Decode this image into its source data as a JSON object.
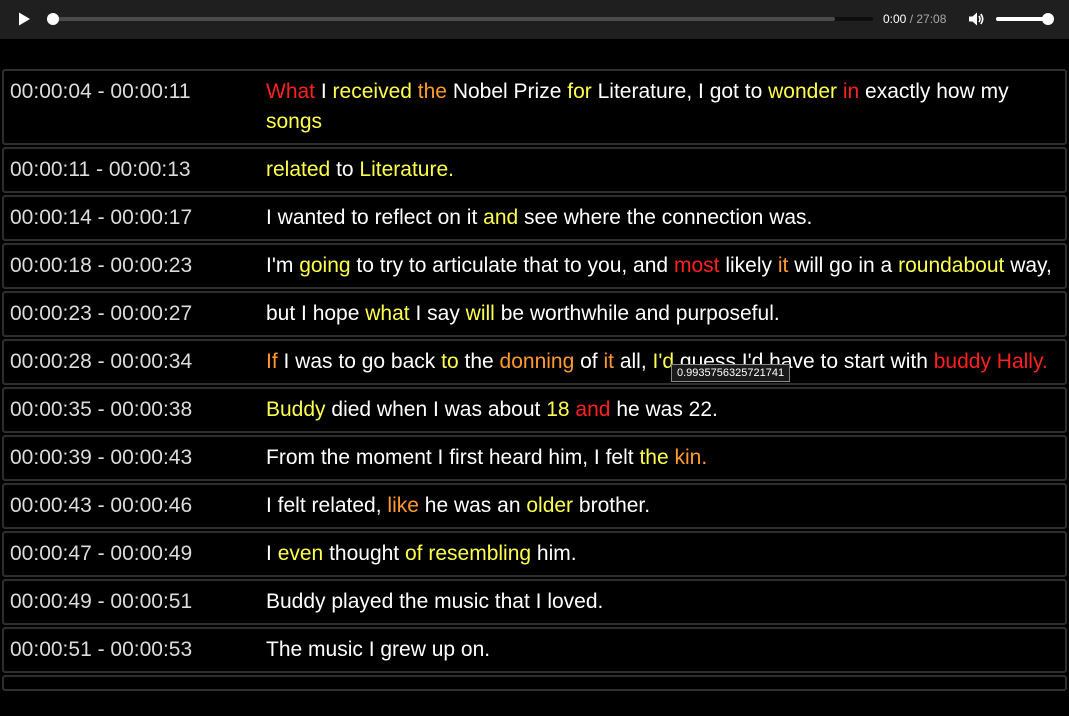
{
  "player": {
    "current_time": "0:00",
    "separator": " / ",
    "duration": "27:08",
    "progress_fraction": 0.0,
    "volume_fraction": 1.0
  },
  "tooltip": "0.9935756325721741",
  "colors": {
    "yellow": "#ffff4d",
    "orange": "#ff9a2e",
    "red": "#ff2020",
    "default": "#ffffff"
  },
  "cues": [
    {
      "time": "00:00:04 - 00:00:11",
      "words": [
        [
          "What",
          "r"
        ],
        [
          " ",
          ""
        ],
        [
          "I",
          ""
        ],
        [
          " ",
          ""
        ],
        [
          "received",
          "y"
        ],
        [
          " ",
          ""
        ],
        [
          "the",
          "o"
        ],
        [
          " ",
          ""
        ],
        [
          "Nobel",
          ""
        ],
        [
          " ",
          ""
        ],
        [
          "Prize",
          ""
        ],
        [
          " ",
          ""
        ],
        [
          "for",
          "y"
        ],
        [
          " ",
          ""
        ],
        [
          "Literature,",
          ""
        ],
        [
          " ",
          ""
        ],
        [
          "I",
          ""
        ],
        [
          " ",
          ""
        ],
        [
          "got",
          ""
        ],
        [
          " ",
          ""
        ],
        [
          "to",
          ""
        ],
        [
          " ",
          ""
        ],
        [
          "wonder",
          "y"
        ],
        [
          " ",
          ""
        ],
        [
          "in",
          "r"
        ],
        [
          " ",
          ""
        ],
        [
          "exactly",
          ""
        ],
        [
          " ",
          ""
        ],
        [
          "how",
          ""
        ],
        [
          " ",
          ""
        ],
        [
          "my",
          ""
        ],
        [
          " ",
          ""
        ],
        [
          "songs",
          "y"
        ]
      ]
    },
    {
      "time": "00:00:11 - 00:00:13",
      "words": [
        [
          "related",
          "y"
        ],
        [
          " ",
          ""
        ],
        [
          "to",
          ""
        ],
        [
          " ",
          ""
        ],
        [
          "Literature.",
          "y"
        ]
      ]
    },
    {
      "time": "00:00:14 - 00:00:17",
      "words": [
        [
          "I wanted to reflect on it",
          ""
        ],
        [
          " ",
          ""
        ],
        [
          "and",
          "y"
        ],
        [
          " ",
          ""
        ],
        [
          "see where the connection was.",
          ""
        ]
      ]
    },
    {
      "time": "00:00:18 - 00:00:23",
      "words": [
        [
          "I'm",
          ""
        ],
        [
          " ",
          ""
        ],
        [
          "going",
          "y"
        ],
        [
          " ",
          ""
        ],
        [
          "to try to articulate that to you, and",
          ""
        ],
        [
          " ",
          ""
        ],
        [
          "most",
          "r"
        ],
        [
          " ",
          ""
        ],
        [
          "likely",
          ""
        ],
        [
          " ",
          ""
        ],
        [
          "it",
          "o"
        ],
        [
          " ",
          ""
        ],
        [
          "will go in a",
          ""
        ],
        [
          " ",
          ""
        ],
        [
          "roundabout",
          "y"
        ],
        [
          " ",
          ""
        ],
        [
          "way,",
          ""
        ]
      ]
    },
    {
      "time": "00:00:23 - 00:00:27",
      "words": [
        [
          "but I hope",
          ""
        ],
        [
          " ",
          ""
        ],
        [
          "what",
          "y"
        ],
        [
          " ",
          ""
        ],
        [
          "I say",
          ""
        ],
        [
          " ",
          ""
        ],
        [
          "will",
          "y"
        ],
        [
          " ",
          ""
        ],
        [
          "be worthwhile and purposeful.",
          ""
        ]
      ]
    },
    {
      "time": "00:00:28 - 00:00:34",
      "words": [
        [
          "If",
          "o"
        ],
        [
          " ",
          ""
        ],
        [
          "I was",
          ""
        ],
        [
          " ",
          ""
        ],
        [
          "to go back",
          ""
        ],
        [
          " ",
          ""
        ],
        [
          "to",
          "y"
        ],
        [
          " ",
          ""
        ],
        [
          "the",
          ""
        ],
        [
          " ",
          ""
        ],
        [
          "donning",
          "o"
        ],
        [
          " ",
          ""
        ],
        [
          "of",
          ""
        ],
        [
          " ",
          ""
        ],
        [
          "it",
          "o"
        ],
        [
          " ",
          ""
        ],
        [
          "all,",
          ""
        ],
        [
          " ",
          ""
        ],
        [
          "I'd",
          "y"
        ],
        [
          " ",
          ""
        ],
        [
          "guess I'd have to start with",
          ""
        ],
        [
          " ",
          ""
        ],
        [
          "buddy",
          "r"
        ],
        [
          " ",
          ""
        ],
        [
          "Hally.",
          "r"
        ]
      ]
    },
    {
      "time": "00:00:35 - 00:00:38",
      "words": [
        [
          "Buddy",
          "y"
        ],
        [
          " ",
          ""
        ],
        [
          "died when I was about",
          ""
        ],
        [
          " ",
          ""
        ],
        [
          "18",
          "y"
        ],
        [
          " ",
          ""
        ],
        [
          "and",
          "r"
        ],
        [
          " ",
          ""
        ],
        [
          "he was 22.",
          ""
        ]
      ]
    },
    {
      "time": "00:00:39 - 00:00:43",
      "words": [
        [
          "From the moment I first heard him, I felt",
          ""
        ],
        [
          " ",
          ""
        ],
        [
          "the",
          "y"
        ],
        [
          " ",
          ""
        ],
        [
          "kin.",
          "o"
        ]
      ]
    },
    {
      "time": "00:00:43 - 00:00:46",
      "words": [
        [
          "I felt related,",
          ""
        ],
        [
          " ",
          ""
        ],
        [
          "like",
          "o"
        ],
        [
          " ",
          ""
        ],
        [
          "he was an",
          ""
        ],
        [
          " ",
          ""
        ],
        [
          "older",
          "y"
        ],
        [
          " ",
          ""
        ],
        [
          "brother.",
          ""
        ]
      ]
    },
    {
      "time": "00:00:47 - 00:00:49",
      "words": [
        [
          "I",
          ""
        ],
        [
          " ",
          ""
        ],
        [
          "even",
          "y"
        ],
        [
          " ",
          ""
        ],
        [
          "thought",
          ""
        ],
        [
          " ",
          ""
        ],
        [
          "of resembling",
          "y"
        ],
        [
          " ",
          ""
        ],
        [
          "him.",
          ""
        ]
      ]
    },
    {
      "time": "00:00:49 - 00:00:51",
      "words": [
        [
          "Buddy played the music that I loved.",
          ""
        ]
      ]
    },
    {
      "time": "00:00:51 - 00:00:53",
      "words": [
        [
          "The music I grew up on.",
          ""
        ]
      ]
    },
    {
      "time": "",
      "words": []
    }
  ]
}
